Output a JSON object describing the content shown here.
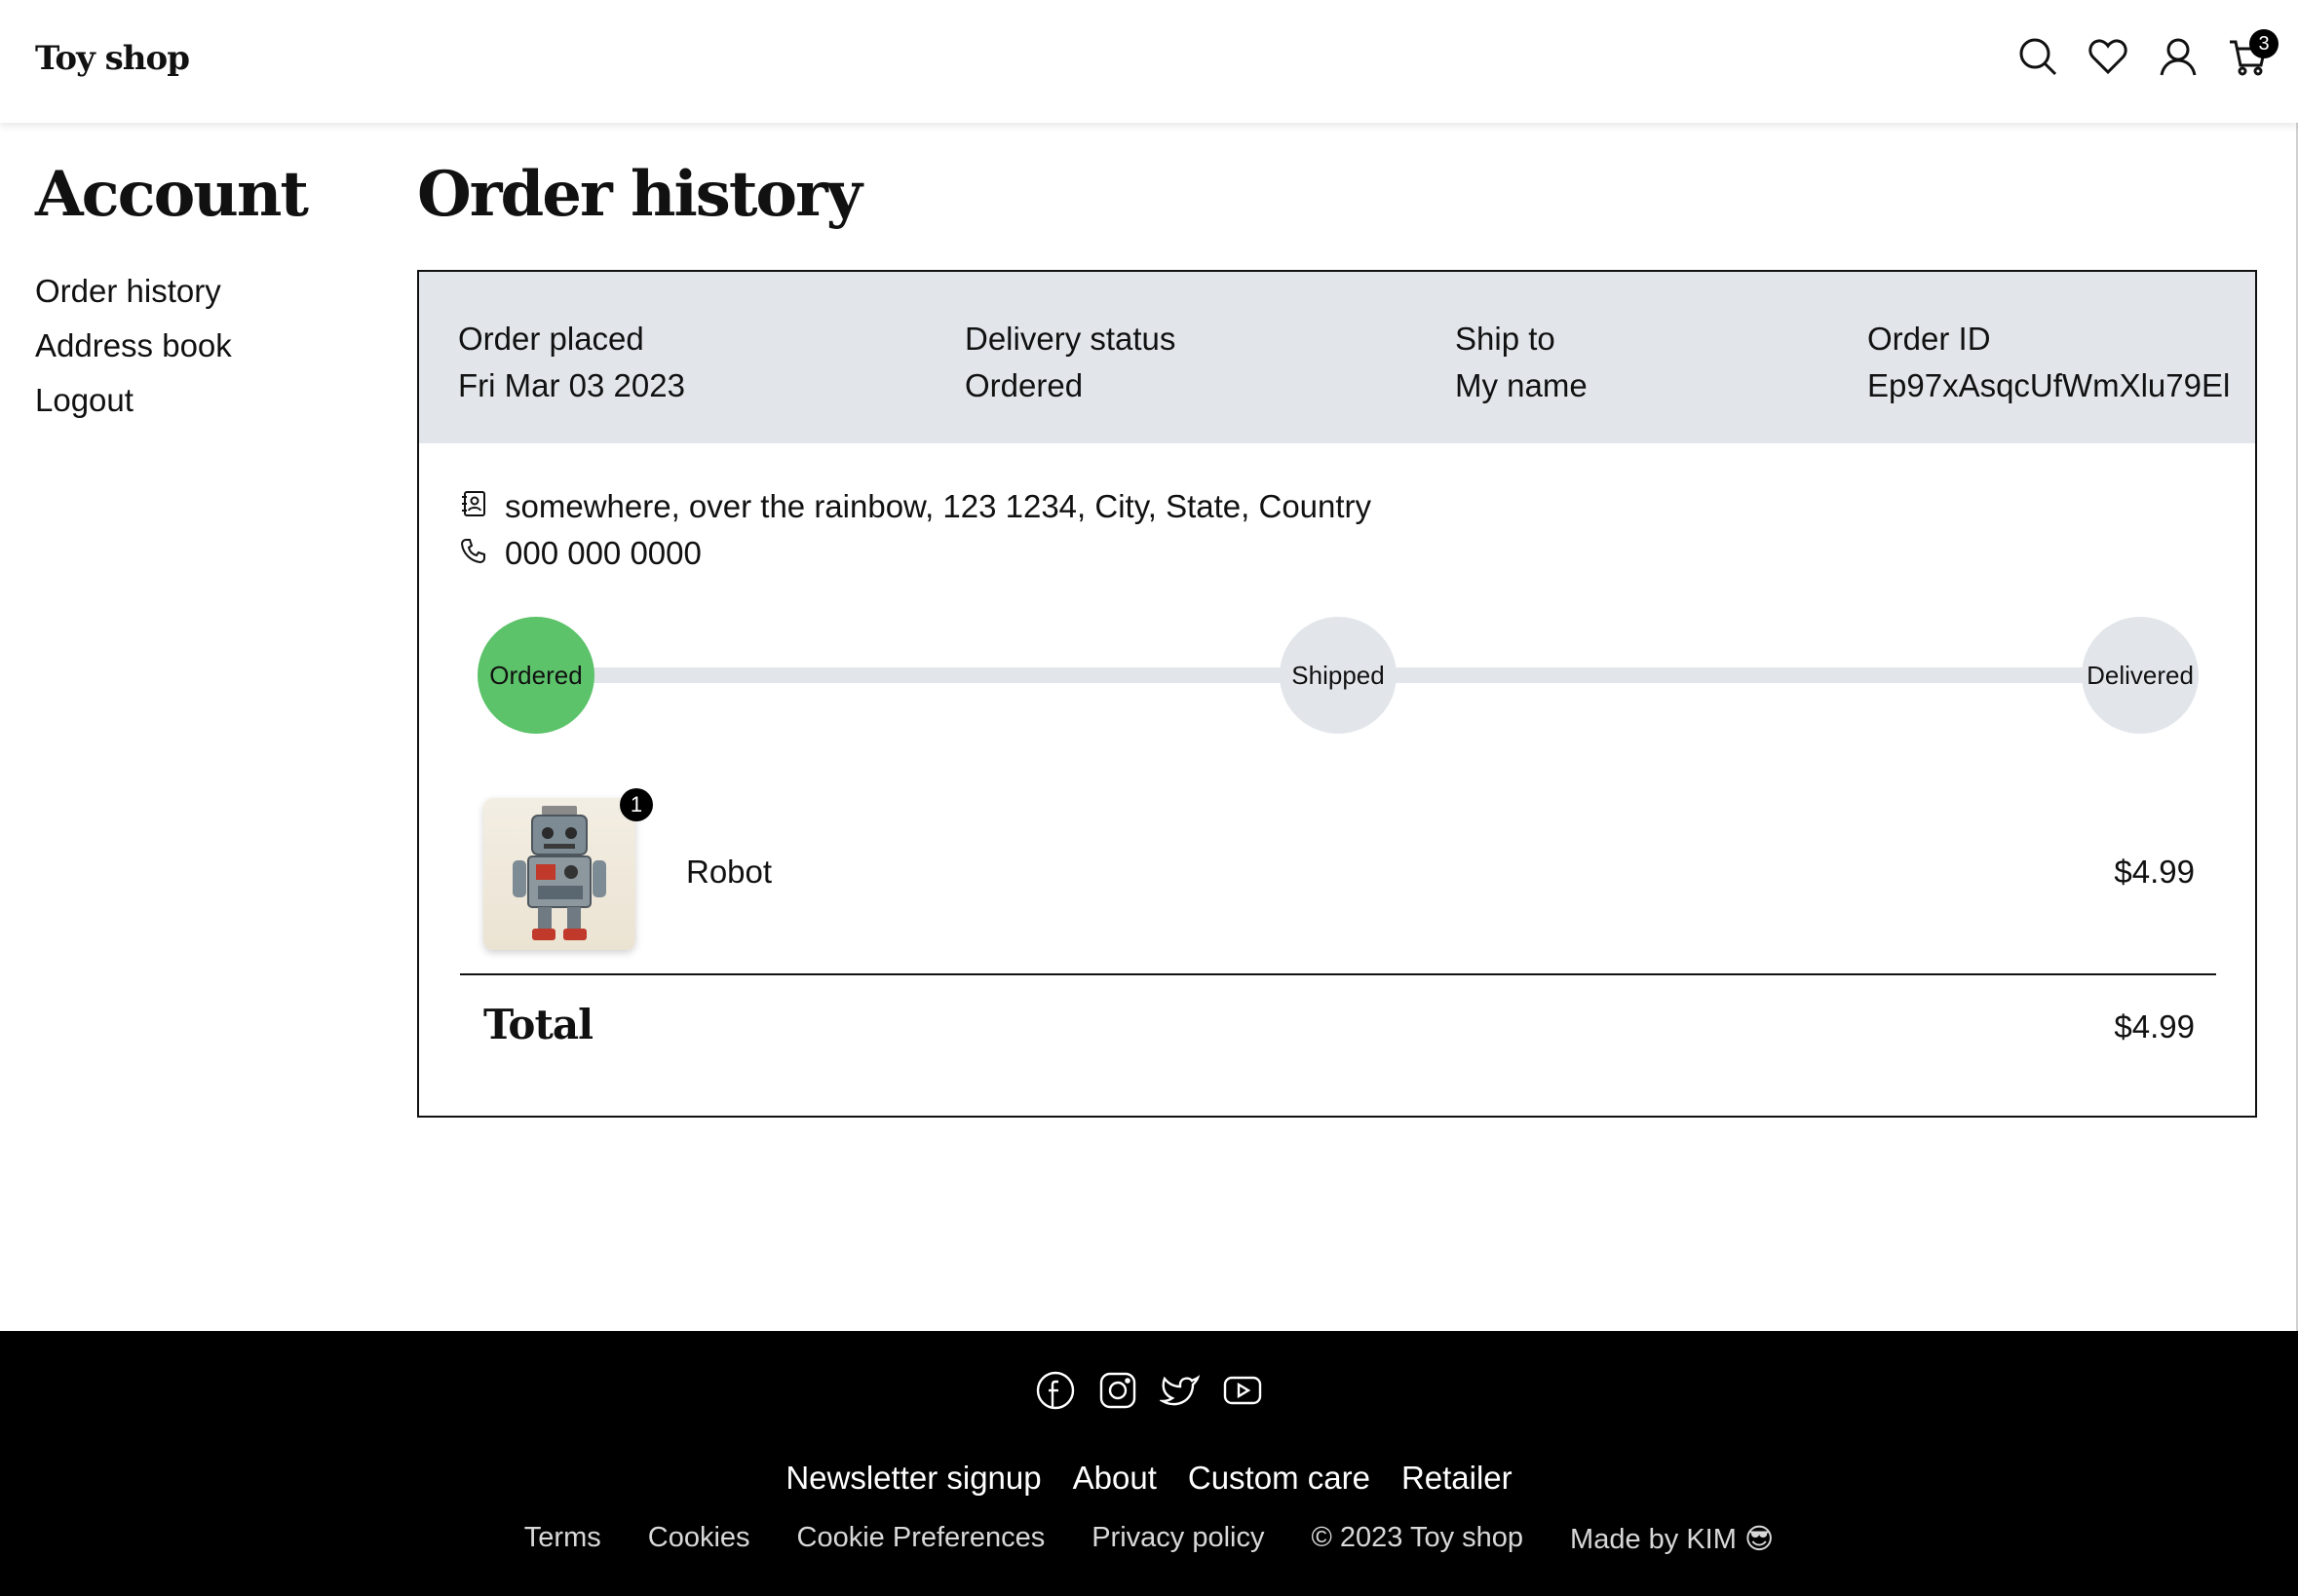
{
  "header": {
    "logo": "Toy shop",
    "cart_count": "3"
  },
  "sidebar": {
    "title": "Account",
    "items": [
      {
        "label": "Order history"
      },
      {
        "label": "Address book"
      },
      {
        "label": "Logout"
      }
    ]
  },
  "main": {
    "title": "Order history",
    "order": {
      "placed_label": "Order placed",
      "placed_value": "Fri Mar 03 2023",
      "status_label": "Delivery status",
      "status_value": "Ordered",
      "ship_label": "Ship to",
      "ship_value": "My name",
      "id_label": "Order ID",
      "id_value": "Ep97xAsqcUfWmXlu79El",
      "address": "somewhere, over the rainbow, 123 1234, City, State, Country",
      "phone": "000 000 0000",
      "steps": [
        {
          "label": "Ordered",
          "done": true
        },
        {
          "label": "Shipped",
          "done": false
        },
        {
          "label": "Delivered",
          "done": false
        }
      ],
      "items": [
        {
          "name": "Robot",
          "qty": "1",
          "price": "$4.99"
        }
      ],
      "total_label": "Total",
      "total_value": "$4.99"
    }
  },
  "footer": {
    "social_icons": [
      "facebook-icon",
      "instagram-icon",
      "twitter-icon",
      "youtube-icon"
    ],
    "links": [
      "Newsletter signup",
      "About",
      "Custom care",
      "Retailer"
    ],
    "sub_links": [
      "Terms",
      "Cookies",
      "Cookie Preferences",
      "Privacy policy"
    ],
    "copyright": "© 2023 Toy shop",
    "credit": "Made by KIM 😎"
  },
  "colors": {
    "progress_done": "#5cc36a",
    "progress_pending": "#e2e6eb",
    "order_header_bg": "#e2e6eb",
    "footer_bg": "#000000"
  }
}
